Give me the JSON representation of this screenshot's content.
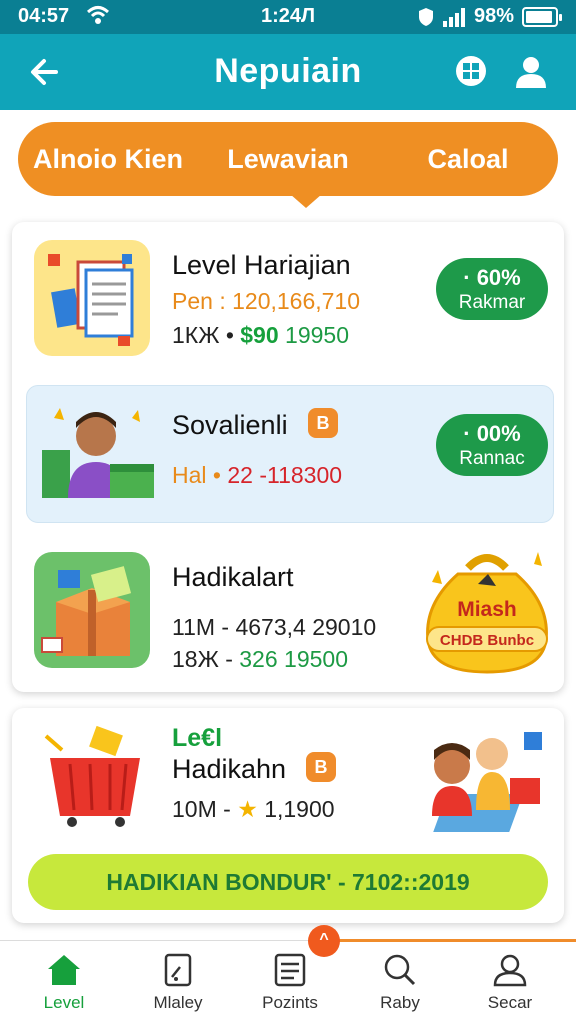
{
  "status_bar": {
    "time_left": "04:57",
    "time_center": "1:24Л",
    "battery_text": "98%"
  },
  "app_bar": {
    "title": "Nepuiain"
  },
  "tabs": [
    "Alnoio Kien",
    "Lewavian",
    "Caloal"
  ],
  "items": [
    {
      "title": "Level Hariajian",
      "line1_prefix": "Pen :",
      "line1_value": "120,166,710",
      "line2_prefix": "1КЖ •",
      "line2_price": "$90",
      "line2_value": "19950",
      "badge_pct": "· 60%",
      "badge_label": "Rakmar"
    },
    {
      "title": "Sovalienli",
      "tag": "B",
      "line1_prefix": "Hal •",
      "line1_value": "22 -118300",
      "badge_pct": "· 00%",
      "badge_label": "Rannac"
    },
    {
      "title": "Hadikalart",
      "line1": "11M - 4673,4 29010",
      "line2_prefix": "18Ж -",
      "line2_value": "326 19500",
      "bag_top": "Miash",
      "bag_bottom": "CHDB Bunbc"
    },
    {
      "small_title": "Le€l",
      "title": "Hadikahn",
      "tag": "B",
      "line1_prefix": "10M -",
      "line1_value": "1,1900"
    }
  ],
  "bonus_bar": "HADIKIAN BONDUR' - 7102::2019",
  "bottom_nav": {
    "notification_count": "^",
    "items": [
      {
        "label": "Level",
        "icon": "home-icon"
      },
      {
        "label": "Mlaley",
        "icon": "document-icon"
      },
      {
        "label": "Pozints",
        "icon": "list-icon"
      },
      {
        "label": "Raby",
        "icon": "search-icon"
      },
      {
        "label": "Secar",
        "icon": "profile-icon"
      }
    ]
  },
  "colors": {
    "status_bar": "#0a7f93",
    "app_bar": "#10a4b9",
    "tab_bar": "#ef8f23",
    "badge": "#1e9a4a",
    "bonus_bar": "#c7e83c",
    "active_nav": "#16a03c"
  }
}
